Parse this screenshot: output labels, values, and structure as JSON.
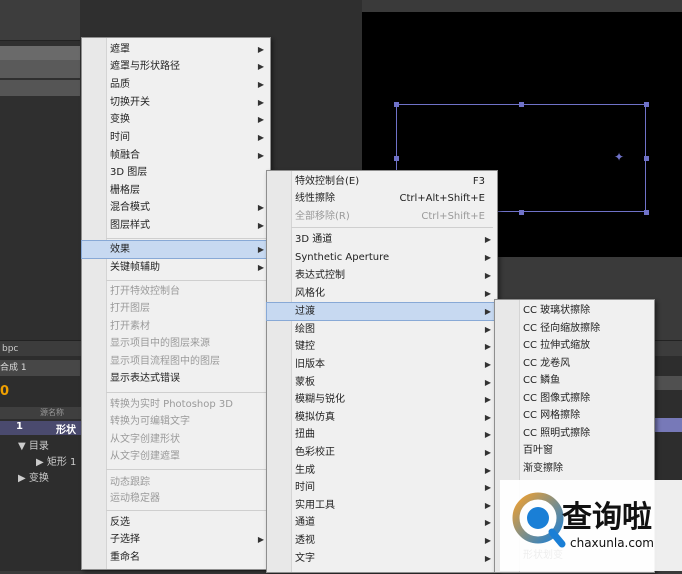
{
  "timeline": {
    "bpc": "bpc",
    "comp_tab": "合成 1",
    "frame": "0",
    "col_header": "源名称",
    "layer_num": "1",
    "layer_name": "形状",
    "sub1": "目录",
    "sub2": "矩形 1",
    "sub3": "变换"
  },
  "menu1": {
    "items": [
      {
        "label": "遮罩",
        "sub": true
      },
      {
        "label": "遮罩与形状路径",
        "sub": true
      },
      {
        "label": "品质",
        "sub": true
      },
      {
        "label": "切换开关",
        "sub": true
      },
      {
        "label": "变换",
        "sub": true
      },
      {
        "label": "时间",
        "sub": true
      },
      {
        "label": "帧融合",
        "sub": true
      },
      {
        "label": "3D 图层",
        "sub": false
      },
      {
        "label": "栅格层",
        "sub": false
      },
      {
        "label": "混合模式",
        "sub": true
      },
      {
        "label": "图层样式",
        "sub": true
      },
      {
        "label": "效果",
        "sub": true
      },
      {
        "label": "关键帧辅助",
        "sub": true
      },
      {
        "label": "打开特效控制台",
        "disabled": true
      },
      {
        "label": "打开图层",
        "disabled": true
      },
      {
        "label": "打开素材",
        "disabled": true
      },
      {
        "label": "显示项目中的图层来源",
        "disabled": true
      },
      {
        "label": "显示项目流程图中的图层",
        "disabled": true
      },
      {
        "label": "显示表达式错误",
        "disabled": false
      },
      {
        "label": "转换为实时 Photoshop 3D",
        "disabled": true
      },
      {
        "label": "转换为可编辑文字",
        "disabled": true
      },
      {
        "label": "从文字创建形状",
        "disabled": true
      },
      {
        "label": "从文字创建遮罩",
        "disabled": true
      },
      {
        "label": "动态跟踪",
        "disabled": true
      },
      {
        "label": "运动稳定器",
        "disabled": true
      },
      {
        "label": "反选",
        "disabled": false
      },
      {
        "label": "子选择",
        "sub": true
      },
      {
        "label": "重命名",
        "disabled": false
      }
    ]
  },
  "menu2": {
    "items": [
      {
        "label": "特效控制台(E)",
        "shortcut": "F3"
      },
      {
        "label": "线性擦除",
        "shortcut": "Ctrl+Alt+Shift+E"
      },
      {
        "label": "全部移除(R)",
        "shortcut": "Ctrl+Shift+E",
        "disabled": true
      },
      {
        "label": "3D 通道",
        "sub": true
      },
      {
        "label": "Synthetic Aperture",
        "sub": true
      },
      {
        "label": "表达式控制",
        "sub": true
      },
      {
        "label": "风格化",
        "sub": true
      },
      {
        "label": "过渡",
        "sub": true
      },
      {
        "label": "绘图",
        "sub": true
      },
      {
        "label": "键控",
        "sub": true
      },
      {
        "label": "旧版本",
        "sub": true
      },
      {
        "label": "蒙板",
        "sub": true
      },
      {
        "label": "模糊与锐化",
        "sub": true
      },
      {
        "label": "模拟仿真",
        "sub": true
      },
      {
        "label": "扭曲",
        "sub": true
      },
      {
        "label": "色彩校正",
        "sub": true
      },
      {
        "label": "生成",
        "sub": true
      },
      {
        "label": "时间",
        "sub": true
      },
      {
        "label": "实用工具",
        "sub": true
      },
      {
        "label": "通道",
        "sub": true
      },
      {
        "label": "透视",
        "sub": true
      },
      {
        "label": "文字",
        "sub": true
      }
    ]
  },
  "menu3": {
    "items": [
      {
        "label": "CC 玻璃状擦除"
      },
      {
        "label": "CC 径向缩放擦除"
      },
      {
        "label": "CC 拉伸式缩放"
      },
      {
        "label": "CC 龙卷风"
      },
      {
        "label": "CC 鳞鱼"
      },
      {
        "label": "CC 图像式擦除"
      },
      {
        "label": "CC 网格擦除"
      },
      {
        "label": "CC 照明式擦除"
      },
      {
        "label": "百叶窗"
      },
      {
        "label": "渐变擦除"
      },
      {
        "label": "形状划变"
      }
    ]
  },
  "watermark": {
    "name": "查询啦",
    "url": "chaxunla.com"
  },
  "colors": {
    "highlight": "#c7d9f1",
    "shape_stroke": "#6f72c8",
    "watermark_blue": "#1a7fd6"
  }
}
